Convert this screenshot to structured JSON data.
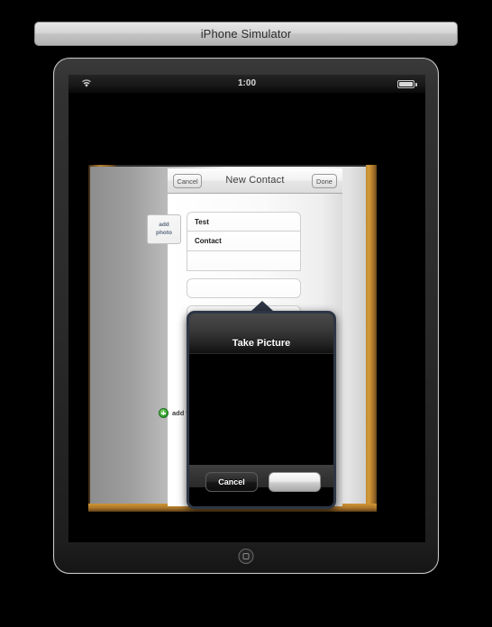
{
  "window": {
    "title": "iPhone Simulator"
  },
  "device": {
    "name": "iPad",
    "home_button_icon": "home-square-icon"
  },
  "statusbar": {
    "wifi_icon": "wifi-icon",
    "time": "1:00",
    "battery_icon": "battery-full-icon"
  },
  "contact_form": {
    "navbar": {
      "cancel_label": "Cancel",
      "title": "New Contact",
      "done_label": "Done"
    },
    "add_photo": {
      "line1": "add",
      "line2": "photo"
    },
    "fields": [
      {
        "value": "Test"
      },
      {
        "value": "Contact"
      },
      {
        "value": ""
      },
      {
        "value": ""
      },
      {
        "value": ""
      },
      {
        "value": ""
      },
      {
        "value": ""
      },
      {
        "value": ""
      },
      {
        "value": ""
      },
      {
        "value": ""
      }
    ],
    "add_field": {
      "icon": "plus-circle-icon",
      "label": "add field"
    }
  },
  "popover": {
    "title": "Take Picture",
    "cancel_label": "Cancel",
    "shutter_label": "",
    "shutter_icon": "camera-shutter-icon"
  },
  "colors": {
    "popover_border": "#2e3645",
    "add_field_green": "#2f9e2f",
    "book_edge_orange": "#c08c32",
    "add_photo_text": "#5d6b80"
  }
}
